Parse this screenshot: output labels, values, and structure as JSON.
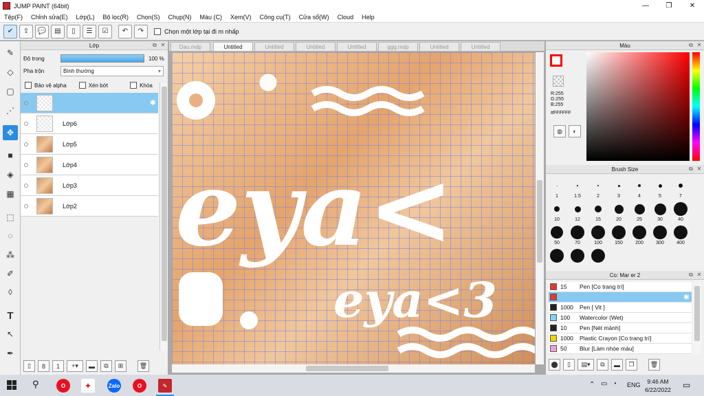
{
  "window": {
    "title": "JUMP PAINT (64bit)"
  },
  "menu": [
    "Tệp(F)",
    "Chỉnh sửa(E)",
    "Lớp(L)",
    "Bộ lọc(R)",
    "Chọn(S)",
    "Chụp(N)",
    "Màu (C)",
    "Xem(V)",
    "Công cụ(T)",
    "Cửa sổ(W)",
    "Cloud",
    "Help"
  ],
  "toolbar": {
    "select_one_layer_label": "Chọn một lớp tại đi  m nhấp"
  },
  "layer_panel": {
    "title": "Lớp",
    "opacity_label": "Độ trong",
    "opacity_value": "100 %",
    "opacity_fraction": 1.0,
    "blend_label": "Pha trộn",
    "blend_value": "Bình thường",
    "protect_alpha": "Bảo vệ alpha",
    "clip": "Xén bớt",
    "lock": "Khóa",
    "layers": [
      {
        "name": "",
        "thumb": "transparent",
        "selected": true
      },
      {
        "name": "Lớp6",
        "thumb": "transparent",
        "selected": false
      },
      {
        "name": "Lớp5",
        "thumb": "image",
        "selected": false
      },
      {
        "name": "Lớp4",
        "thumb": "image",
        "selected": false
      },
      {
        "name": "Lớp3",
        "thumb": "image",
        "selected": false
      },
      {
        "name": "Lớp2",
        "thumb": "image",
        "selected": false
      }
    ]
  },
  "tabs": [
    "Dau.mdp",
    "Untitled",
    "Untitled",
    "Untitled",
    "Untitled",
    "ggg.mdp",
    "Untitled",
    "Untitled"
  ],
  "active_tab": 1,
  "canvas_text": {
    "large": "eya<",
    "small": "eya<3"
  },
  "color_panel": {
    "title": "Màu",
    "r": "R:255",
    "g": "G:255",
    "b": "B:255",
    "hex": "#FFFFFF",
    "primary": "#ff0000",
    "secondary": "#ffffff"
  },
  "brush_panel": {
    "title": "Brush Size",
    "sizes": [
      "1",
      "1.5",
      "2",
      "3",
      "4",
      "5",
      "7",
      "10",
      "12",
      "15",
      "20",
      "25",
      "30",
      "40",
      "50",
      "70",
      "100",
      "150",
      "200",
      "300",
      "400"
    ]
  },
  "marker_panel": {
    "title": "Co: Mar  er 2",
    "items": [
      {
        "size": "15",
        "name": "Pen [Co trang trí]",
        "color": "#e53935",
        "selected": false
      },
      {
        "size": "",
        "name": "",
        "color": "#e53935",
        "selected": true
      },
      {
        "size": "1000",
        "name": "Pen [ Vit ]",
        "color": "#222222",
        "selected": false
      },
      {
        "size": "100",
        "name": "Watercolor (Wet)",
        "color": "#7fd4f0",
        "selected": false
      },
      {
        "size": "10",
        "name": "Pen [Nét mảnh]",
        "color": "#222222",
        "selected": false
      },
      {
        "size": "1000",
        "name": "Plastic Crayon [Co trang trí]",
        "color": "#f2d500",
        "selected": false
      },
      {
        "size": "50",
        "name": "Blur [Làm nhòe màu]",
        "color": "#f0a0d8",
        "selected": false
      }
    ]
  },
  "taskbar": {
    "time": "9:46 AM",
    "date": "6/22/2022",
    "lang": "ENG",
    "zalo": "Zalo"
  }
}
